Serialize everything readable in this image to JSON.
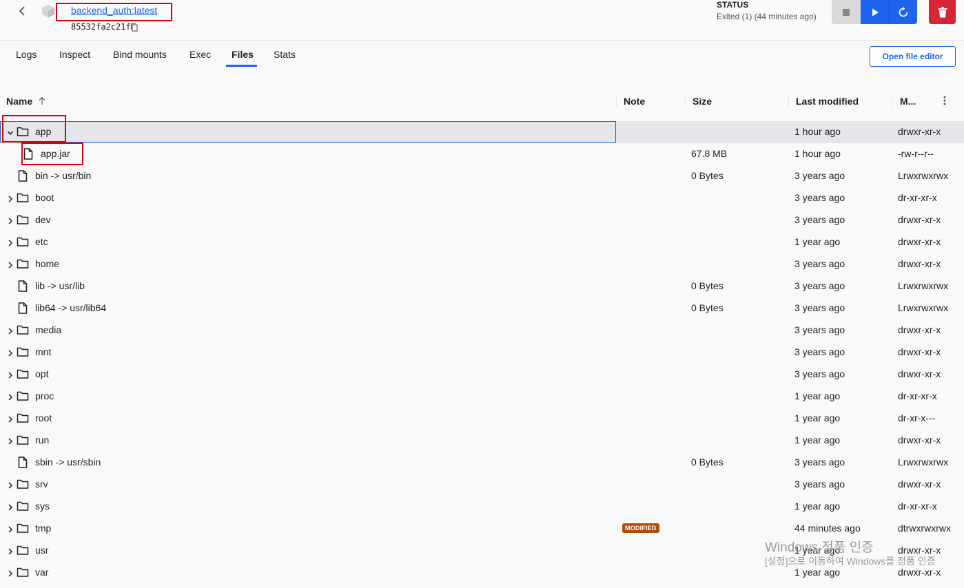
{
  "header": {
    "image_name": "backend_auth:latest",
    "container_id": "85532fa2c21f",
    "status_label": "STATUS",
    "status_value": "Exited (1) (44 minutes ago)"
  },
  "tabs": [
    {
      "label": "Logs"
    },
    {
      "label": "Inspect"
    },
    {
      "label": "Bind mounts"
    },
    {
      "label": "Exec"
    },
    {
      "label": "Files",
      "active": true
    },
    {
      "label": "Stats"
    }
  ],
  "open_editor_label": "Open file editor",
  "columns": {
    "name": "Name",
    "note": "Note",
    "size": "Size",
    "last_modified": "Last modified",
    "mode": "M..."
  },
  "rows": [
    {
      "name": "app",
      "type": "folder",
      "expanded": true,
      "selected": true,
      "note": "",
      "size": "",
      "modified": "1 hour ago",
      "mode": "drwxr-xr-x"
    },
    {
      "name": "app.jar",
      "type": "file",
      "child": true,
      "note": "",
      "size": "67.8 MB",
      "modified": "1 hour ago",
      "mode": "-rw-r--r--"
    },
    {
      "name": "bin -> usr/bin",
      "type": "file",
      "note": "",
      "size": "0 Bytes",
      "modified": "3 years ago",
      "mode": "Lrwxrwxrwx"
    },
    {
      "name": "boot",
      "type": "folder",
      "note": "",
      "size": "",
      "modified": "3 years ago",
      "mode": "dr-xr-xr-x"
    },
    {
      "name": "dev",
      "type": "folder",
      "note": "",
      "size": "",
      "modified": "3 years ago",
      "mode": "drwxr-xr-x"
    },
    {
      "name": "etc",
      "type": "folder",
      "note": "",
      "size": "",
      "modified": "1 year ago",
      "mode": "drwxr-xr-x"
    },
    {
      "name": "home",
      "type": "folder",
      "note": "",
      "size": "",
      "modified": "3 years ago",
      "mode": "drwxr-xr-x"
    },
    {
      "name": "lib -> usr/lib",
      "type": "file",
      "note": "",
      "size": "0 Bytes",
      "modified": "3 years ago",
      "mode": "Lrwxrwxrwx"
    },
    {
      "name": "lib64 -> usr/lib64",
      "type": "file",
      "note": "",
      "size": "0 Bytes",
      "modified": "3 years ago",
      "mode": "Lrwxrwxrwx"
    },
    {
      "name": "media",
      "type": "folder",
      "note": "",
      "size": "",
      "modified": "3 years ago",
      "mode": "drwxr-xr-x"
    },
    {
      "name": "mnt",
      "type": "folder",
      "note": "",
      "size": "",
      "modified": "3 years ago",
      "mode": "drwxr-xr-x"
    },
    {
      "name": "opt",
      "type": "folder",
      "note": "",
      "size": "",
      "modified": "3 years ago",
      "mode": "drwxr-xr-x"
    },
    {
      "name": "proc",
      "type": "folder",
      "note": "",
      "size": "",
      "modified": "1 year ago",
      "mode": "dr-xr-xr-x"
    },
    {
      "name": "root",
      "type": "folder",
      "note": "",
      "size": "",
      "modified": "1 year ago",
      "mode": "dr-xr-x---"
    },
    {
      "name": "run",
      "type": "folder",
      "note": "",
      "size": "",
      "modified": "1 year ago",
      "mode": "drwxr-xr-x"
    },
    {
      "name": "sbin -> usr/sbin",
      "type": "file",
      "note": "",
      "size": "0 Bytes",
      "modified": "3 years ago",
      "mode": "Lrwxrwxrwx"
    },
    {
      "name": "srv",
      "type": "folder",
      "note": "",
      "size": "",
      "modified": "3 years ago",
      "mode": "drwxr-xr-x"
    },
    {
      "name": "sys",
      "type": "folder",
      "note": "",
      "size": "",
      "modified": "1 year ago",
      "mode": "dr-xr-xr-x"
    },
    {
      "name": "tmp",
      "type": "folder",
      "note": "MODIFIED",
      "size": "",
      "modified": "44 minutes ago",
      "mode": "dtrwxrwxrwx"
    },
    {
      "name": "usr",
      "type": "folder",
      "note": "",
      "size": "",
      "modified": "1 year ago",
      "mode": "drwxr-xr-x"
    },
    {
      "name": "var",
      "type": "folder",
      "note": "",
      "size": "",
      "modified": "1 year ago",
      "mode": "drwxr-xr-x"
    }
  ],
  "watermark": {
    "line1": "Windows 정품 인증",
    "line2": "[설정]으로 이동하여 Windows를 정품 인증"
  },
  "colors": {
    "accent": "#1d63ed",
    "danger": "#d52536",
    "badge": "#b14e0b",
    "annotation": "#e0000a",
    "selected_row": "#e5e5ea"
  }
}
